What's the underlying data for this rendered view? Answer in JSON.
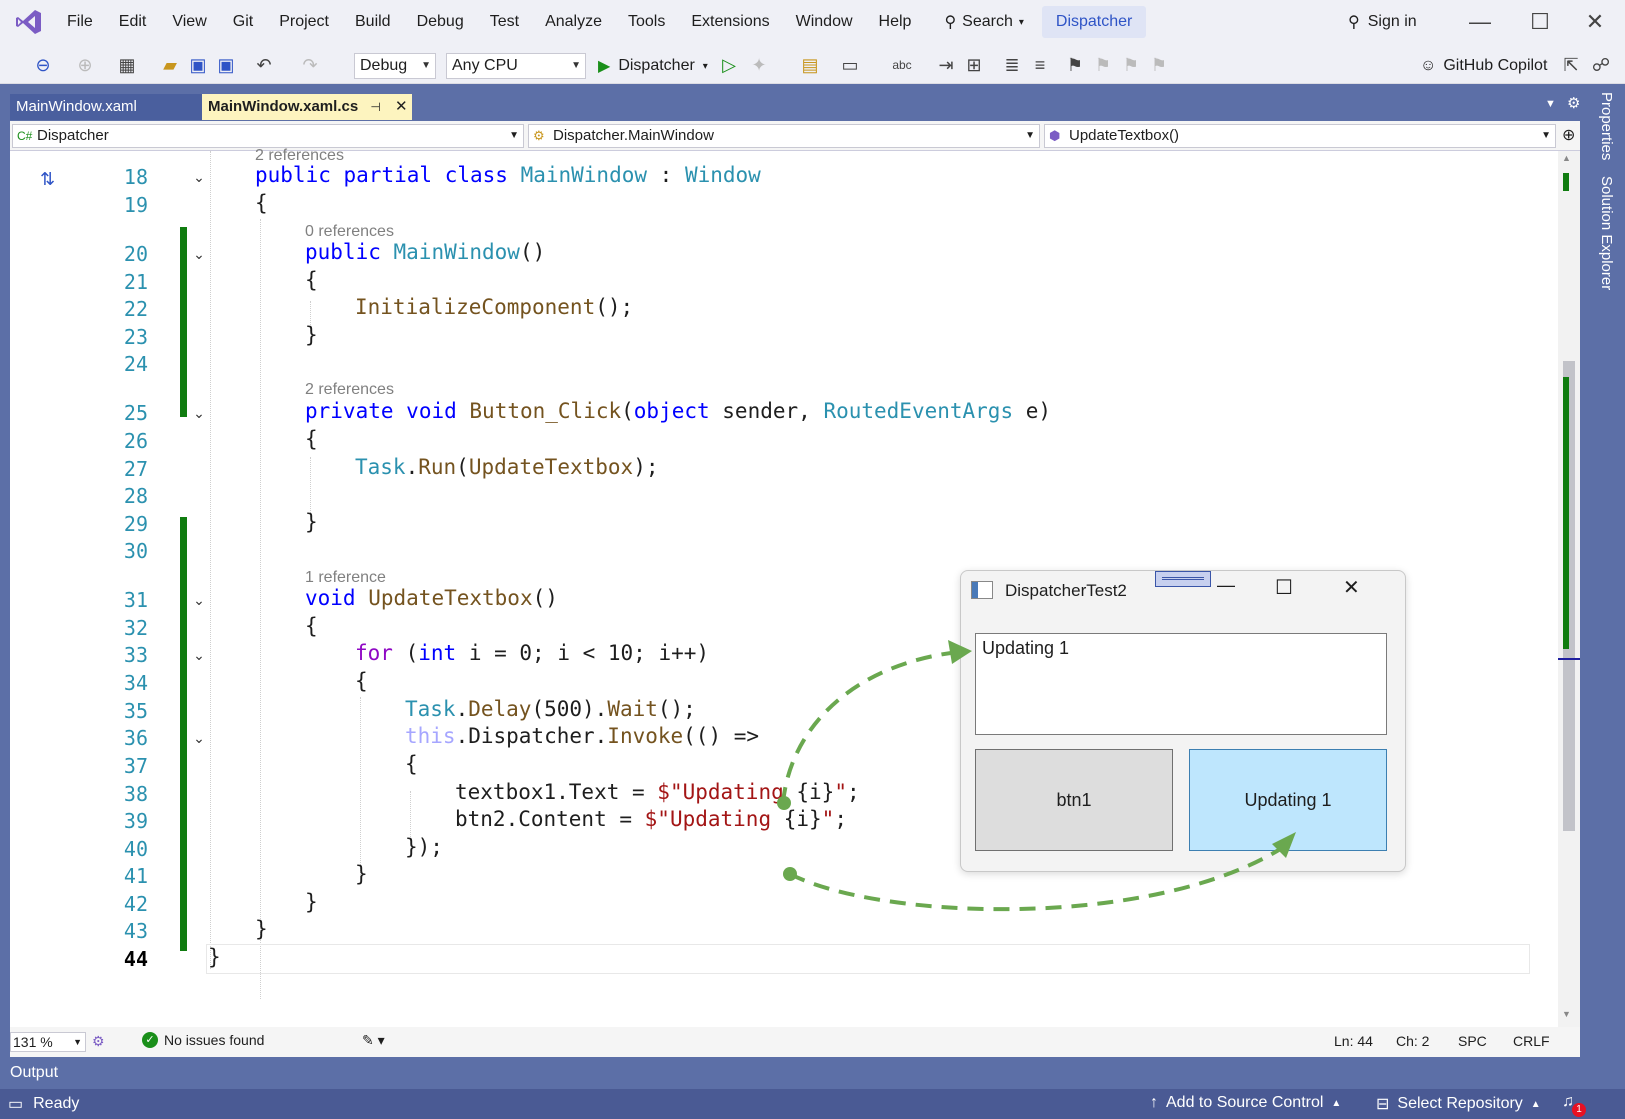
{
  "menubar": {
    "items": [
      "File",
      "Edit",
      "View",
      "Git",
      "Project",
      "Build",
      "Debug",
      "Test",
      "Analyze",
      "Tools",
      "Extensions",
      "Window",
      "Help"
    ],
    "search_label": "Search",
    "solution_name": "Dispatcher",
    "sign_in": "Sign in"
  },
  "toolbar": {
    "configuration": "Debug",
    "platform": "Any CPU",
    "run_target": "Dispatcher",
    "copilot": "GitHub Copilot"
  },
  "tabs": [
    {
      "label": "MainWindow.xaml"
    },
    {
      "label": "MainWindow.xaml.cs",
      "pin": "⊣"
    }
  ],
  "navbar": {
    "project": "Dispatcher",
    "type": "Dispatcher.MainWindow",
    "member": "UpdateTextbox()"
  },
  "editor": {
    "refs": {
      "r18": "2 references",
      "r20": "0 references",
      "r25": "2 references",
      "r31": "1 reference"
    },
    "lines": [
      "18",
      "19",
      "20",
      "21",
      "22",
      "23",
      "24",
      "25",
      "26",
      "27",
      "28",
      "29",
      "30",
      "31",
      "32",
      "33",
      "34",
      "35",
      "36",
      "37",
      "38",
      "39",
      "40",
      "41",
      "42",
      "43",
      "44"
    ]
  },
  "status": {
    "zoom": "131 %",
    "issues": "No issues found",
    "ln": "Ln: 44",
    "ch": "Ch: 2",
    "spc": "SPC",
    "crlf": "CRLF"
  },
  "output_label": "Output",
  "bottom": {
    "ready": "Ready",
    "source_control": "Add to Source Control",
    "repository": "Select Repository",
    "notifications": "1"
  },
  "side_panels": [
    "Properties",
    "Solution Explorer"
  ],
  "popup": {
    "title": "DispatcherTest2",
    "textbox_value": "Updating 1",
    "btn1": "btn1",
    "btn2": "Updating 1"
  },
  "colors": {
    "keyword": "#0000ff",
    "type": "#2b91af",
    "method": "#74531f",
    "control": "#8f08c4",
    "string": "#a31515",
    "accent": "#5c6fa7",
    "change_bar": "#107c10",
    "arrow": "#6aa84f"
  }
}
